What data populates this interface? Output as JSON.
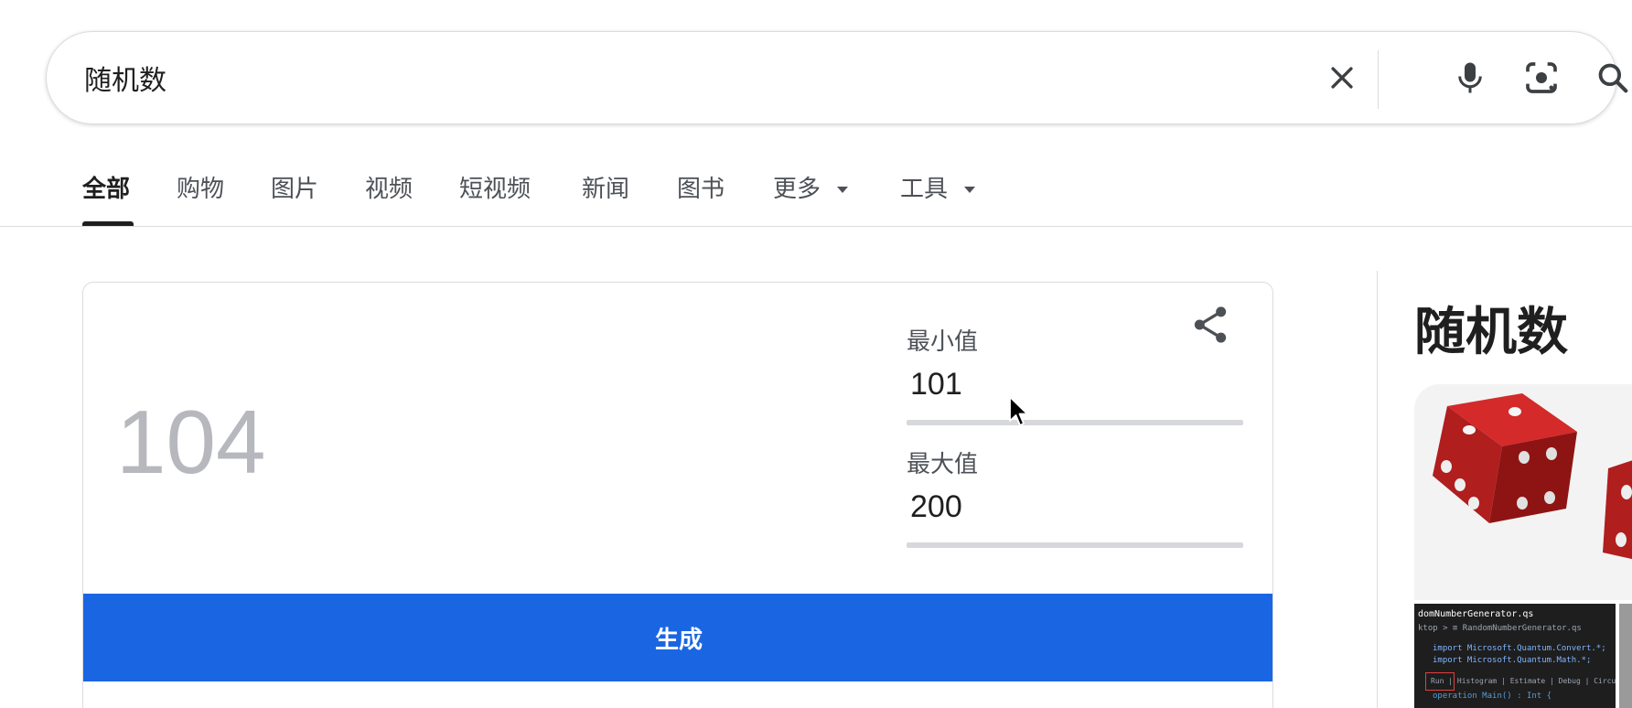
{
  "search": {
    "query": "随机数",
    "clear_icon": "close-icon",
    "mic_icon": "microphone-icon",
    "lens_icon": "camera-lens-icon",
    "search_icon": "search-icon"
  },
  "tabs": {
    "items": [
      {
        "label": "全部",
        "active": true
      },
      {
        "label": "购物"
      },
      {
        "label": "图片"
      },
      {
        "label": "视频"
      },
      {
        "label": "短视频"
      },
      {
        "label": "新闻"
      },
      {
        "label": "图书"
      },
      {
        "label": "更多",
        "dropdown": true
      },
      {
        "label": "工具",
        "dropdown": true
      }
    ]
  },
  "widget": {
    "result": "104",
    "min_label": "最小值",
    "min_value": "101",
    "max_label": "最大值",
    "max_value": "200",
    "generate_label": "生成",
    "share_icon": "share-icon",
    "accent_color": "#1a66e2"
  },
  "knowledge_panel": {
    "title": "随机数",
    "image_dice": "red-dice-image",
    "image_code": {
      "tab_label": "domNumberGenerator.qs",
      "breadcrumb": "ktop > ≡ RandomNumberGenerator.qs",
      "line1": "import Microsoft.Quantum.Convert.*;",
      "line2": "import Microsoft.Quantum.Math.*;",
      "codelens": "Run | Histogram | Estimate | Debug | Circuit",
      "line3": "operation Main() : Int {"
    }
  }
}
